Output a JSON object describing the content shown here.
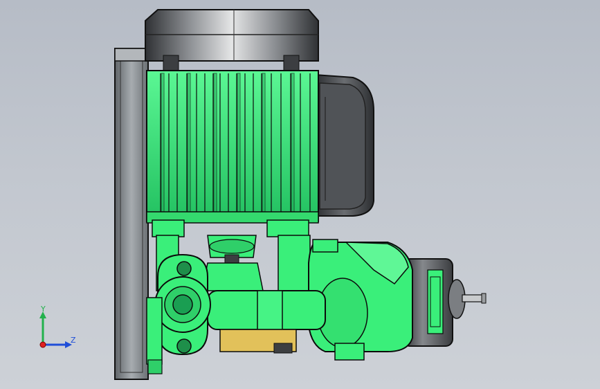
{
  "viewport": {
    "background": [
      "#b6bcc6",
      "#cdd1d7"
    ]
  },
  "triad": {
    "y_label": "Y",
    "z_label": "Z",
    "colors": {
      "x": "#e02020",
      "y": "#22b14c",
      "z": "#1f4ed8"
    }
  },
  "model": {
    "colors": {
      "green": "#3aef7a",
      "green_shade": "#1fb25a",
      "outline": "#0b0b0b",
      "metal_dark": "#4e5155",
      "metal_light": "#d9dadc",
      "plate": "#9aa0a5",
      "brass": "#e2c15a"
    },
    "parts": [
      "motor-cap",
      "motor-body",
      "terminal-box",
      "mounting-plate",
      "coupling-bracket",
      "pump-flange",
      "pump-volute",
      "pump-rear-housing",
      "shaft-end"
    ]
  }
}
